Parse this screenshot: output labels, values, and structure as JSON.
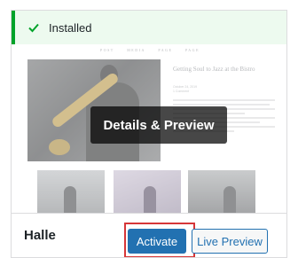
{
  "notice": {
    "text": "Installed",
    "icon": "checkmark-icon",
    "color": "#00a32a"
  },
  "preview": {
    "nav_items": [
      "POST",
      "MEDIA",
      "PAGE",
      "PAGE"
    ],
    "post_title": "Getting Soul to Jazz at the Bistro",
    "post_meta": [
      "October 24, 2019",
      "1 Comment"
    ],
    "overlay_button": "Details & Preview"
  },
  "footer": {
    "theme_name": "Halle",
    "activate_label": "Activate",
    "live_preview_label": "Live Preview",
    "accent_color": "#2271b1",
    "highlight_color": "#d63638"
  }
}
